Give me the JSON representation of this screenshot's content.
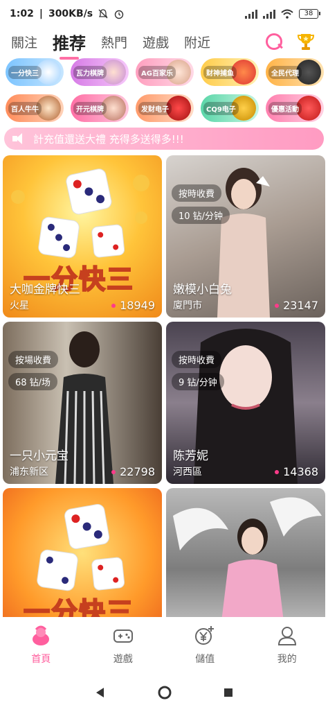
{
  "status": {
    "time": "1:02",
    "speed": "300KB/s",
    "battery": "38"
  },
  "tabs": [
    {
      "label": "關注"
    },
    {
      "label": "推荐"
    },
    {
      "label": "熱門"
    },
    {
      "label": "遊戲"
    },
    {
      "label": "附近"
    }
  ],
  "games": [
    {
      "label": "一分快三",
      "color": "#a9d8ff"
    },
    {
      "label": "瓦力棋牌",
      "color": "#f2b8f6"
    },
    {
      "label": "AG百家乐",
      "color": "#ffd3e0"
    },
    {
      "label": "财神捕鱼",
      "color": "#ffe7a3"
    },
    {
      "label": "全民代理",
      "color": "#ffd9a8"
    },
    {
      "label": "百人牛牛",
      "color": "#ffc6a1"
    },
    {
      "label": "开元棋牌",
      "color": "#ffb8d1"
    },
    {
      "label": "发财电子",
      "color": "#ffd2b8"
    },
    {
      "label": "CQ9电子",
      "color": "#b8f0d8"
    },
    {
      "label": "優惠活動",
      "color": "#ffcbe0"
    }
  ],
  "notice": "計充值還送大禮 充得多送得多!!!",
  "cards": [
    {
      "name": "大咖金牌快三",
      "location": "火星",
      "count": "18949",
      "tag1": "",
      "tag2": "",
      "type": "game"
    },
    {
      "name": "嫩模小白兔",
      "location": "廈門市",
      "count": "23147",
      "tag1": "按時收費",
      "tag2": "10 钻/分钟",
      "type": "photo"
    },
    {
      "name": "一只小元宝",
      "location": "浦东新区",
      "count": "22798",
      "tag1": "按場收費",
      "tag2": "68 钻/场",
      "type": "photo"
    },
    {
      "name": "陈芳妮",
      "location": "河西區",
      "count": "14368",
      "tag1": "按時收費",
      "tag2": "9 钻/分钟",
      "type": "photo"
    },
    {
      "name": "",
      "location": "",
      "count": "",
      "tag1": "",
      "tag2": "",
      "type": "game"
    },
    {
      "name": "",
      "location": "",
      "count": "",
      "tag1": "",
      "tag2": "",
      "type": "photo"
    }
  ],
  "game_banner": {
    "title": "一分快三"
  },
  "bottom_nav": [
    {
      "label": "首頁",
      "icon": "home-icon"
    },
    {
      "label": "遊戲",
      "icon": "gamepad-icon"
    },
    {
      "label": "儲值",
      "icon": "yen-plus-icon"
    },
    {
      "label": "我的",
      "icon": "user-icon"
    }
  ]
}
